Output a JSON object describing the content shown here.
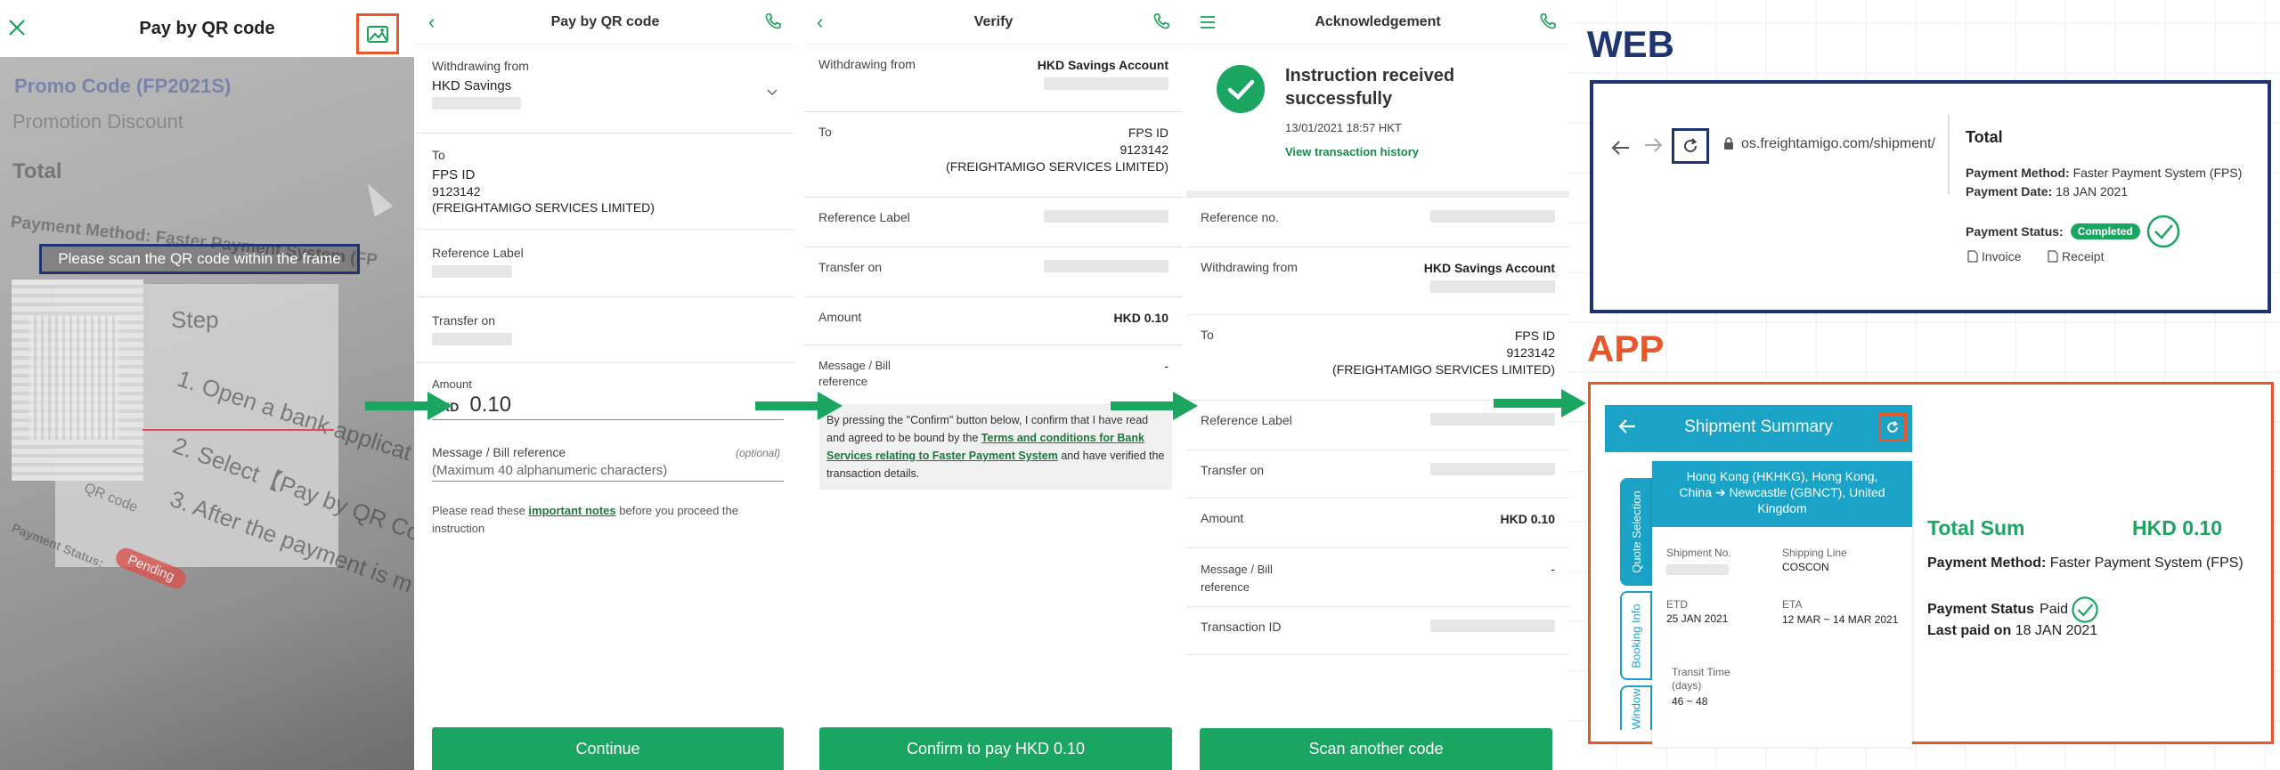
{
  "panel1": {
    "title": "Pay by QR code",
    "scan_hint": "Please scan the QR code within the frame",
    "camera_text": {
      "promo_code": "Promo Code (FP2021S)",
      "promotion_discount": "Promotion Discount",
      "total": "Total",
      "payment_method": "Payment Method: Faster Payment System (FP",
      "step": "Step",
      "step1": "1. Open a bank applicat",
      "step2": "2. Select【Pay by QR Co",
      "step3": "3. After the payment is m",
      "qr_code": "QR code",
      "payment_status": "Payment Status:",
      "pending": "Pending"
    }
  },
  "panel2": {
    "title": "Pay by QR code",
    "withdrawing_label": "Withdrawing from",
    "withdrawing_value": "HKD Savings",
    "to_label": "To",
    "to_type": "FPS ID",
    "to_id": "9123142",
    "to_name": "(FREIGHTAMIGO SERVICES LIMITED)",
    "ref_label": "Reference Label",
    "transfer_label": "Transfer on",
    "amount_label": "Amount",
    "amount_currency": "HKD",
    "amount_value": "0.10",
    "message_label": "Message / Bill reference",
    "optional": "(optional)",
    "message_placeholder": "(Maximum 40 alphanumeric characters)",
    "note_prefix": "Please read these",
    "note_link": "important notes",
    "note_suffix": "before you proceed the instruction",
    "button": "Continue"
  },
  "panel3": {
    "title": "Verify",
    "withdrawing_label": "Withdrawing from",
    "withdrawing_value": "HKD Savings Account",
    "to_label": "To",
    "to_type": "FPS ID",
    "to_id": "9123142",
    "to_name": "(FREIGHTAMIGO SERVICES LIMITED)",
    "ref_label": "Reference Label",
    "transfer_label": "Transfer on",
    "amount_label": "Amount",
    "amount_value": "HKD 0.10",
    "message_label": "Message / Bill reference",
    "message_value": "-",
    "terms_prefix": "By pressing the \"Confirm\" button below, I confirm that I have read and agreed to be bound by the",
    "terms_link": "Terms and conditions for Bank Services relating to Faster Payment System",
    "terms_suffix": "and have verified the transaction details.",
    "button": "Confirm to pay HKD 0.10"
  },
  "panel4": {
    "title": "Acknowledgement",
    "status_line1": "Instruction received",
    "status_line2": "successfully",
    "timestamp": "13/01/2021 18:57 HKT",
    "history_link": "View transaction history",
    "ref_no_label": "Reference no.",
    "withdrawing_label": "Withdrawing from",
    "withdrawing_value": "HKD Savings Account",
    "to_label": "To",
    "to_type": "FPS ID",
    "to_id": "9123142",
    "to_name": "(FREIGHTAMIGO SERVICES LIMITED)",
    "ref_label": "Reference Label",
    "transfer_label": "Transfer on",
    "amount_label": "Amount",
    "amount_value": "HKD 0.10",
    "message_label": "Message / Bill reference",
    "message_value": "-",
    "txn_label": "Transaction ID",
    "button": "Scan another code"
  },
  "web": {
    "heading": "WEB",
    "url": "os.freightamigo.com/shipment/",
    "total": "Total",
    "payment_method_label": "Payment Method:",
    "payment_method_value": "Faster Payment System (FPS)",
    "payment_date_label": "Payment Date:",
    "payment_date_value": "18 JAN 2021",
    "payment_status_label": "Payment Status:",
    "payment_status_value": "Completed",
    "invoice": "Invoice",
    "receipt": "Receipt"
  },
  "app": {
    "heading": "APP",
    "header_title": "Shipment Summary",
    "tabs": [
      "Quote Selection",
      "Booking Info",
      "Window"
    ],
    "route": "Hong Kong (HKHKG), Hong Kong, China ➔ Newcastle (GBNCT), United Kingdom",
    "shipment_no_label": "Shipment No.",
    "shipping_line_label": "Shipping Line",
    "shipping_line_value": "COSCON",
    "etd_label": "ETD",
    "etd_value": "25 JAN 2021",
    "eta_label": "ETA",
    "eta_value": "12 MAR ~ 14 MAR 2021",
    "transit_label": "Transit Time (days)",
    "transit_value": "46 ~ 48",
    "total_sum_label": "Total Sum",
    "total_sum_value": "HKD 0.10",
    "payment_method_label": "Payment Method:",
    "payment_method_value": "Faster Payment System (FPS)",
    "payment_status_label": "Payment Status",
    "payment_status_value": "Paid",
    "last_paid_label": "Last paid on",
    "last_paid_value": "18 JAN 2021"
  },
  "colors": {
    "green": "#1aa661",
    "navy": "#1f3570",
    "orange": "#e8572a",
    "app_blue": "#1ba3c7"
  }
}
